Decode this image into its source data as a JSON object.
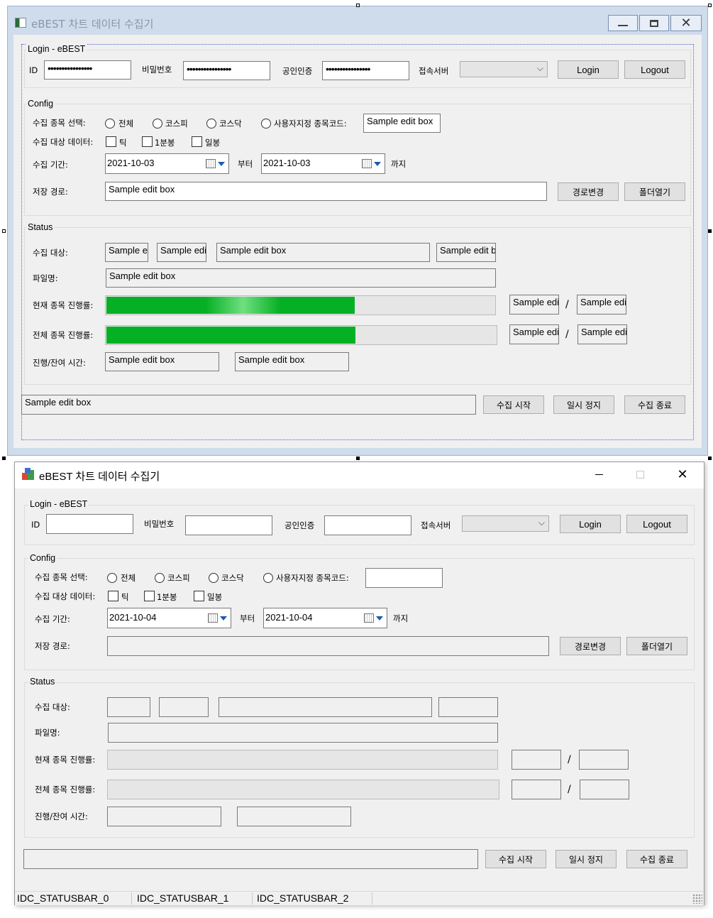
{
  "design": {
    "title": "eBEST 차트 데이터 수집기",
    "groups": {
      "login": "Login - eBEST",
      "config": "Config",
      "status": "Status"
    },
    "labels": {
      "id": "ID",
      "password": "비밀번호",
      "cert": "공인인증",
      "server": "접속서버",
      "target_select": "수집 종목 선택:",
      "target_data": "수집 대상 데이터:",
      "period": "수집 기간:",
      "from": "부터",
      "until": "까지",
      "save_path": "저장 경로:",
      "collect_target": "수집 대상:",
      "filename": "파일명:",
      "cur_progress": "현재 종목 진행률:",
      "total_progress": "전체 종목 진행률:",
      "time": "진행/잔여 시간:",
      "slash": "/"
    },
    "radios": [
      "전체",
      "코스피",
      "코스닥",
      "사용자지정 종목코드:"
    ],
    "checks": [
      "틱",
      "1분봉",
      "일봉"
    ],
    "password_mask": "••••••••••••••••",
    "edit_sample": "Sample edit box",
    "truncated": {
      "a": "Sample e",
      "b": "Sample edi",
      "c": "Sample edit b",
      "d": "Sample edi"
    },
    "date_from": "2021-10-03",
    "date_to": "2021-10-03",
    "buttons": {
      "login": "Login",
      "logout": "Logout",
      "path_change": "경로변경",
      "open_folder": "폴더열기",
      "start": "수집 시작",
      "pause": "일시 정지",
      "stop": "수집 종료"
    },
    "cur_progress_value": 0.64,
    "total_progress_value": 0.64
  },
  "runtime": {
    "title": "eBEST 차트 데이터 수집기",
    "groups": {
      "login": "Login - eBEST",
      "config": "Config",
      "status": "Status"
    },
    "labels": {
      "id": "ID",
      "password": "비밀번호",
      "cert": "공인인증",
      "server": "접속서버",
      "target_select": "수집 종목 선택:",
      "target_data": "수집 대상 데이터:",
      "period": "수집 기간:",
      "from": "부터",
      "until": "까지",
      "save_path": "저장 경로:",
      "collect_target": "수집 대상:",
      "filename": "파일명:",
      "cur_progress": "현재 종목 진행률:",
      "total_progress": "전체 종목 진행률:",
      "time": "진행/잔여 시간:",
      "slash": "/"
    },
    "radios": [
      "전체",
      "코스피",
      "코스닥",
      "사용자지정 종목코드:"
    ],
    "checks": [
      "틱",
      "1분봉",
      "일봉"
    ],
    "date_from": "2021-10-04",
    "date_to": "2021-10-04",
    "buttons": {
      "login": "Login",
      "logout": "Logout",
      "path_change": "경로변경",
      "open_folder": "폴더열기",
      "start": "수집 시작",
      "pause": "일시 정지",
      "stop": "수집 종료"
    },
    "statusbar": [
      "IDC_STATUSBAR_0",
      "IDC_STATUSBAR_1",
      "IDC_STATUSBAR_2"
    ],
    "cur_progress_value": 0,
    "total_progress_value": 0
  },
  "icons": {
    "window_min": "minimize-icon",
    "window_max": "maximize-icon",
    "window_close": "close-icon",
    "app": "app-icon",
    "calendar": "calendar-icon",
    "dropdown": "chevron-down-icon",
    "grip": "resize-grip-icon"
  },
  "colors": {
    "progress_green": "#06b025",
    "dialog_bg": "#f0f0f0",
    "designer_frame": "#cfdceb"
  }
}
